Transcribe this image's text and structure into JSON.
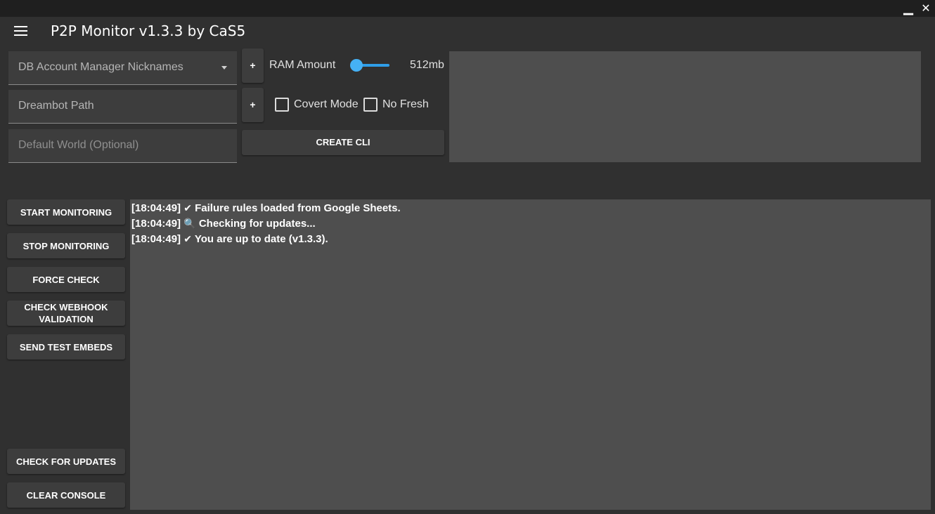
{
  "window": {
    "minimize_glyph": "▁",
    "close_glyph": "✕"
  },
  "appbar": {
    "title": "P2P Monitor v1.3.3 by CaS5"
  },
  "inputs": {
    "accounts_placeholder": "DB Account Manager Nicknames",
    "dreambot_path_placeholder": "Dreambot Path",
    "default_world_placeholder": "Default World (Optional)"
  },
  "controls": {
    "plus_label": "+",
    "ram_label": "RAM Amount",
    "ram_value": "512mb",
    "ram_slider_level": 0.0,
    "covert_mode_label": "Covert Mode",
    "covert_mode_checked": false,
    "no_fresh_label": "No Fresh",
    "no_fresh_checked": false,
    "create_cli_label": "CREATE CLI"
  },
  "sidebar": {
    "start_monitoring": "START MONITORING",
    "stop_monitoring": "STOP MONITORING",
    "force_check": "FORCE CHECK",
    "check_webhook": "CHECK WEBHOOK VALIDATION",
    "send_test_embeds": "SEND TEST EMBEDS",
    "check_for_updates": "CHECK FOR UPDATES",
    "clear_console": "CLEAR CONSOLE"
  },
  "console": {
    "lines": [
      {
        "time": "[18:04:49]",
        "icon": "check-icon",
        "glyph": "✔",
        "text": "Failure rules loaded from Google Sheets."
      },
      {
        "time": "[18:04:49]",
        "icon": "magnifier-icon",
        "glyph": "🔍",
        "text": "Checking for updates..."
      },
      {
        "time": "[18:04:49]",
        "icon": "check-icon",
        "glyph": "✔",
        "text": "You are up to date (v1.3.3)."
      }
    ]
  },
  "colors": {
    "background": "#303030",
    "panel": "#3d3d3d",
    "console_bg": "#4e4e4e",
    "accent": "#45b1f5"
  }
}
